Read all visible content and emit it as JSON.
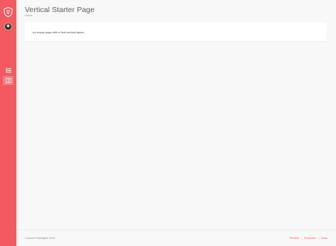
{
  "sidebar": {
    "accent_color": "#f25961",
    "logo_icon": "shield-icon",
    "avatar": "user-avatar",
    "items": [
      {
        "icon": "layers-icon",
        "active": false
      },
      {
        "icon": "layout-icon",
        "active": true
      }
    ]
  },
  "header": {
    "title": "Vertical Starter Page",
    "breadcrumb": "Home"
  },
  "main": {
    "card_text": "An empty page with a fluid vertical layout."
  },
  "footer": {
    "copyright": "Colored Strategies 2021",
    "links": [
      "Review",
      "Purchase",
      "Docs"
    ],
    "separator": "|"
  }
}
